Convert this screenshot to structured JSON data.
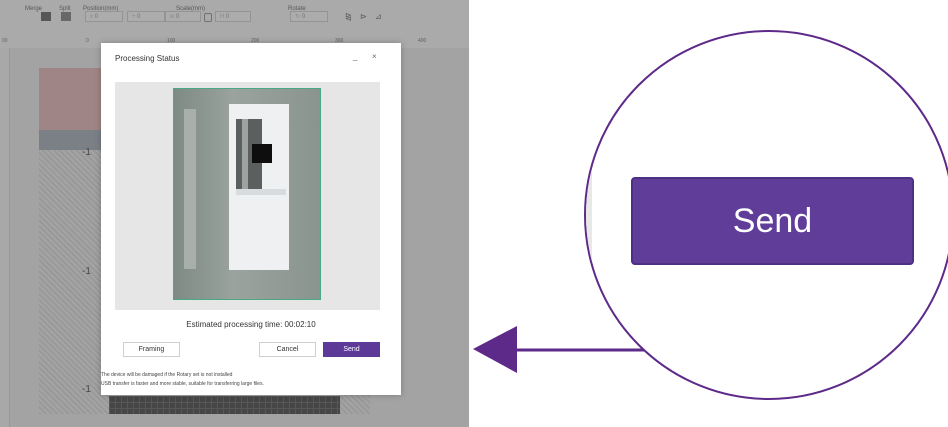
{
  "toolbar": {
    "merge_label": "Merge",
    "split_label": "Split",
    "position_label": "Position(mm)",
    "position_x": "0",
    "position_y": "0",
    "scale_label": "Scale(mm)",
    "scale_w": "0",
    "scale_h": "0",
    "rotate_label": "Rotate",
    "rotate_value": "0"
  },
  "ruler": {
    "marks": [
      "00",
      "0",
      "100",
      "200",
      "300",
      "400"
    ]
  },
  "canvas": {
    "axis_labels": [
      "-1",
      "-1",
      "-1"
    ]
  },
  "dialog": {
    "title": "Processing Status",
    "minimize_symbol": "_",
    "close_symbol": "×",
    "estimate_label": "Estimated processing time: 00:02:10",
    "framing_label": "Framing",
    "cancel_label": "Cancel",
    "send_label": "Send",
    "note_rotary": "The device will be damaged if the Rotary set is not installed",
    "note_usb": "USB transfer is faster and more stable, suitable for transferring large files."
  },
  "callout": {
    "send_label": "Send"
  },
  "colors": {
    "accent": "#5e3a98",
    "callout_ring": "#5e2a8a",
    "preview_border": "#49a985"
  }
}
